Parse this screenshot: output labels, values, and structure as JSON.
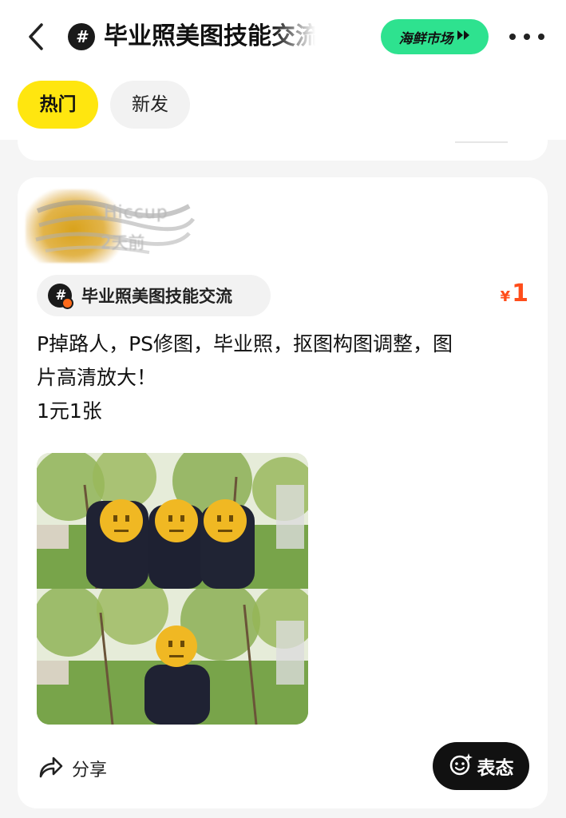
{
  "header": {
    "topic_badge": "#",
    "title": "毕业照美图技能交流",
    "market_label": "海鲜市场"
  },
  "tabs": [
    {
      "label": "热门",
      "active": true
    },
    {
      "label": "新发",
      "active": false
    }
  ],
  "post": {
    "user_name": "Hiccup",
    "time": "2天前",
    "topic": "毕业照美图技能交流",
    "price_symbol": "¥",
    "price": "1",
    "text_lines": [
      "P掉路人，PS修图，毕业照，抠图构图调整，图",
      "片高清放大！",
      "1元1张"
    ],
    "actions": {
      "share": "分享",
      "react": "表态"
    }
  },
  "colors": {
    "accent_yellow": "#ffe60f",
    "market_green": "#2ee28f",
    "price_orange": "#ff4d1a"
  }
}
